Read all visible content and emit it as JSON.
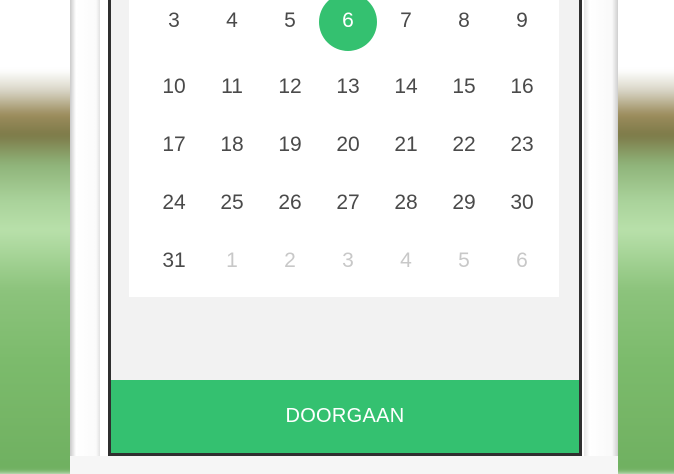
{
  "calendar": {
    "weeks": [
      [
        {
          "day": "3",
          "muted": false
        },
        {
          "day": "4",
          "muted": false
        },
        {
          "day": "5",
          "muted": false
        },
        {
          "day": "6",
          "muted": false,
          "selected": true
        },
        {
          "day": "7",
          "muted": false
        },
        {
          "day": "8",
          "muted": false
        },
        {
          "day": "9",
          "muted": false
        }
      ],
      [
        {
          "day": "10",
          "muted": false
        },
        {
          "day": "11",
          "muted": false
        },
        {
          "day": "12",
          "muted": false
        },
        {
          "day": "13",
          "muted": false
        },
        {
          "day": "14",
          "muted": false
        },
        {
          "day": "15",
          "muted": false
        },
        {
          "day": "16",
          "muted": false
        }
      ],
      [
        {
          "day": "17",
          "muted": false
        },
        {
          "day": "18",
          "muted": false
        },
        {
          "day": "19",
          "muted": false
        },
        {
          "day": "20",
          "muted": false
        },
        {
          "day": "21",
          "muted": false
        },
        {
          "day": "22",
          "muted": false
        },
        {
          "day": "23",
          "muted": false
        }
      ],
      [
        {
          "day": "24",
          "muted": false
        },
        {
          "day": "25",
          "muted": false
        },
        {
          "day": "26",
          "muted": false
        },
        {
          "day": "27",
          "muted": false
        },
        {
          "day": "28",
          "muted": false
        },
        {
          "day": "29",
          "muted": false
        },
        {
          "day": "30",
          "muted": false
        }
      ],
      [
        {
          "day": "31",
          "muted": false
        },
        {
          "day": "1",
          "muted": true
        },
        {
          "day": "2",
          "muted": true
        },
        {
          "day": "3",
          "muted": true
        },
        {
          "day": "4",
          "muted": true
        },
        {
          "day": "5",
          "muted": true
        },
        {
          "day": "6",
          "muted": true
        }
      ]
    ],
    "selected_day": "6",
    "accent_color": "#34c170"
  },
  "footer": {
    "continue_label": "DOORGAAN"
  }
}
